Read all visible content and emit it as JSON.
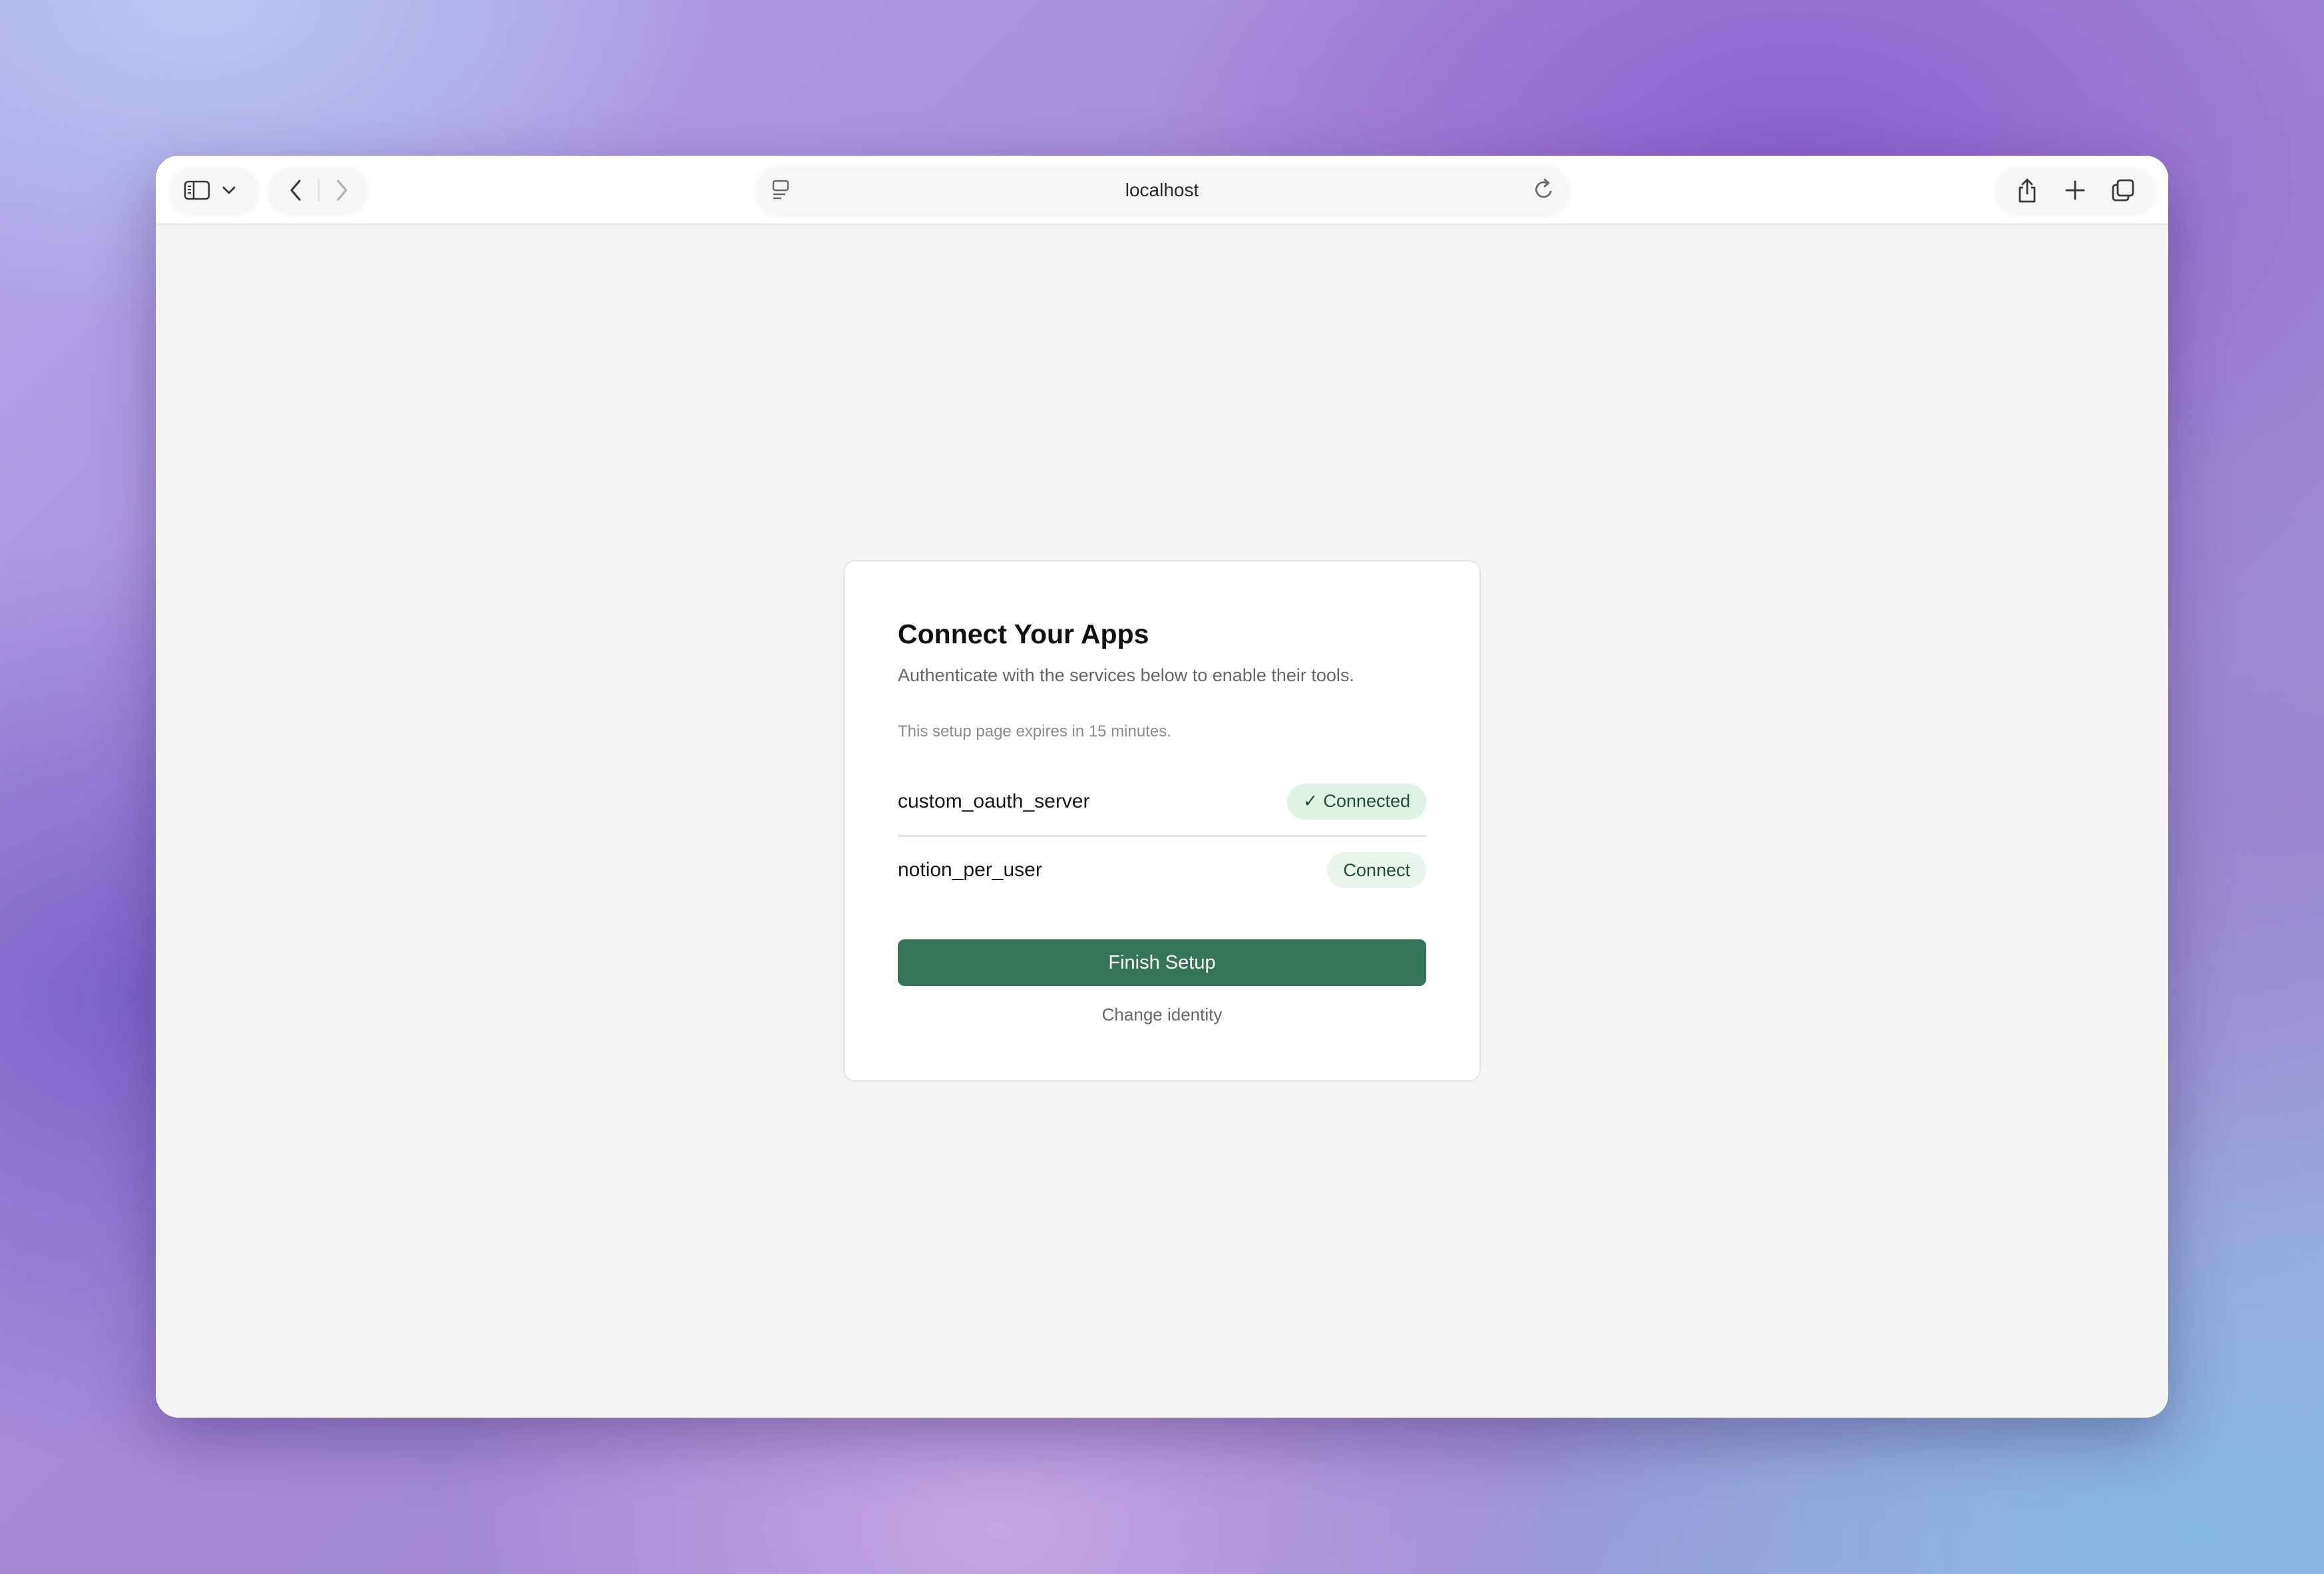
{
  "browser": {
    "url": "localhost",
    "icons": {
      "sidebar": "sidebar-icon",
      "dropdown": "chevron-down-icon",
      "back": "chevron-left-icon",
      "forward": "chevron-right-icon",
      "page": "page-menu-icon",
      "reload": "reload-icon",
      "share": "share-icon",
      "new_tab": "plus-icon",
      "tabs": "tab-overview-icon"
    }
  },
  "card": {
    "title": "Connect Your Apps",
    "subtitle": "Authenticate with the services below to enable their tools.",
    "expires": "This setup page expires in 15 minutes.",
    "services": [
      {
        "name": "custom_oauth_server",
        "status": "Connected",
        "status_icon": "✓"
      },
      {
        "name": "notion_per_user",
        "action": "Connect"
      }
    ],
    "finish_label": "Finish Setup",
    "change_identity_label": "Change identity"
  },
  "colors": {
    "primary": "#347458",
    "badge_connected_bg": "#dff3e4",
    "badge_connect_bg": "#e9f4ec",
    "badge_text": "#1f4f32"
  }
}
